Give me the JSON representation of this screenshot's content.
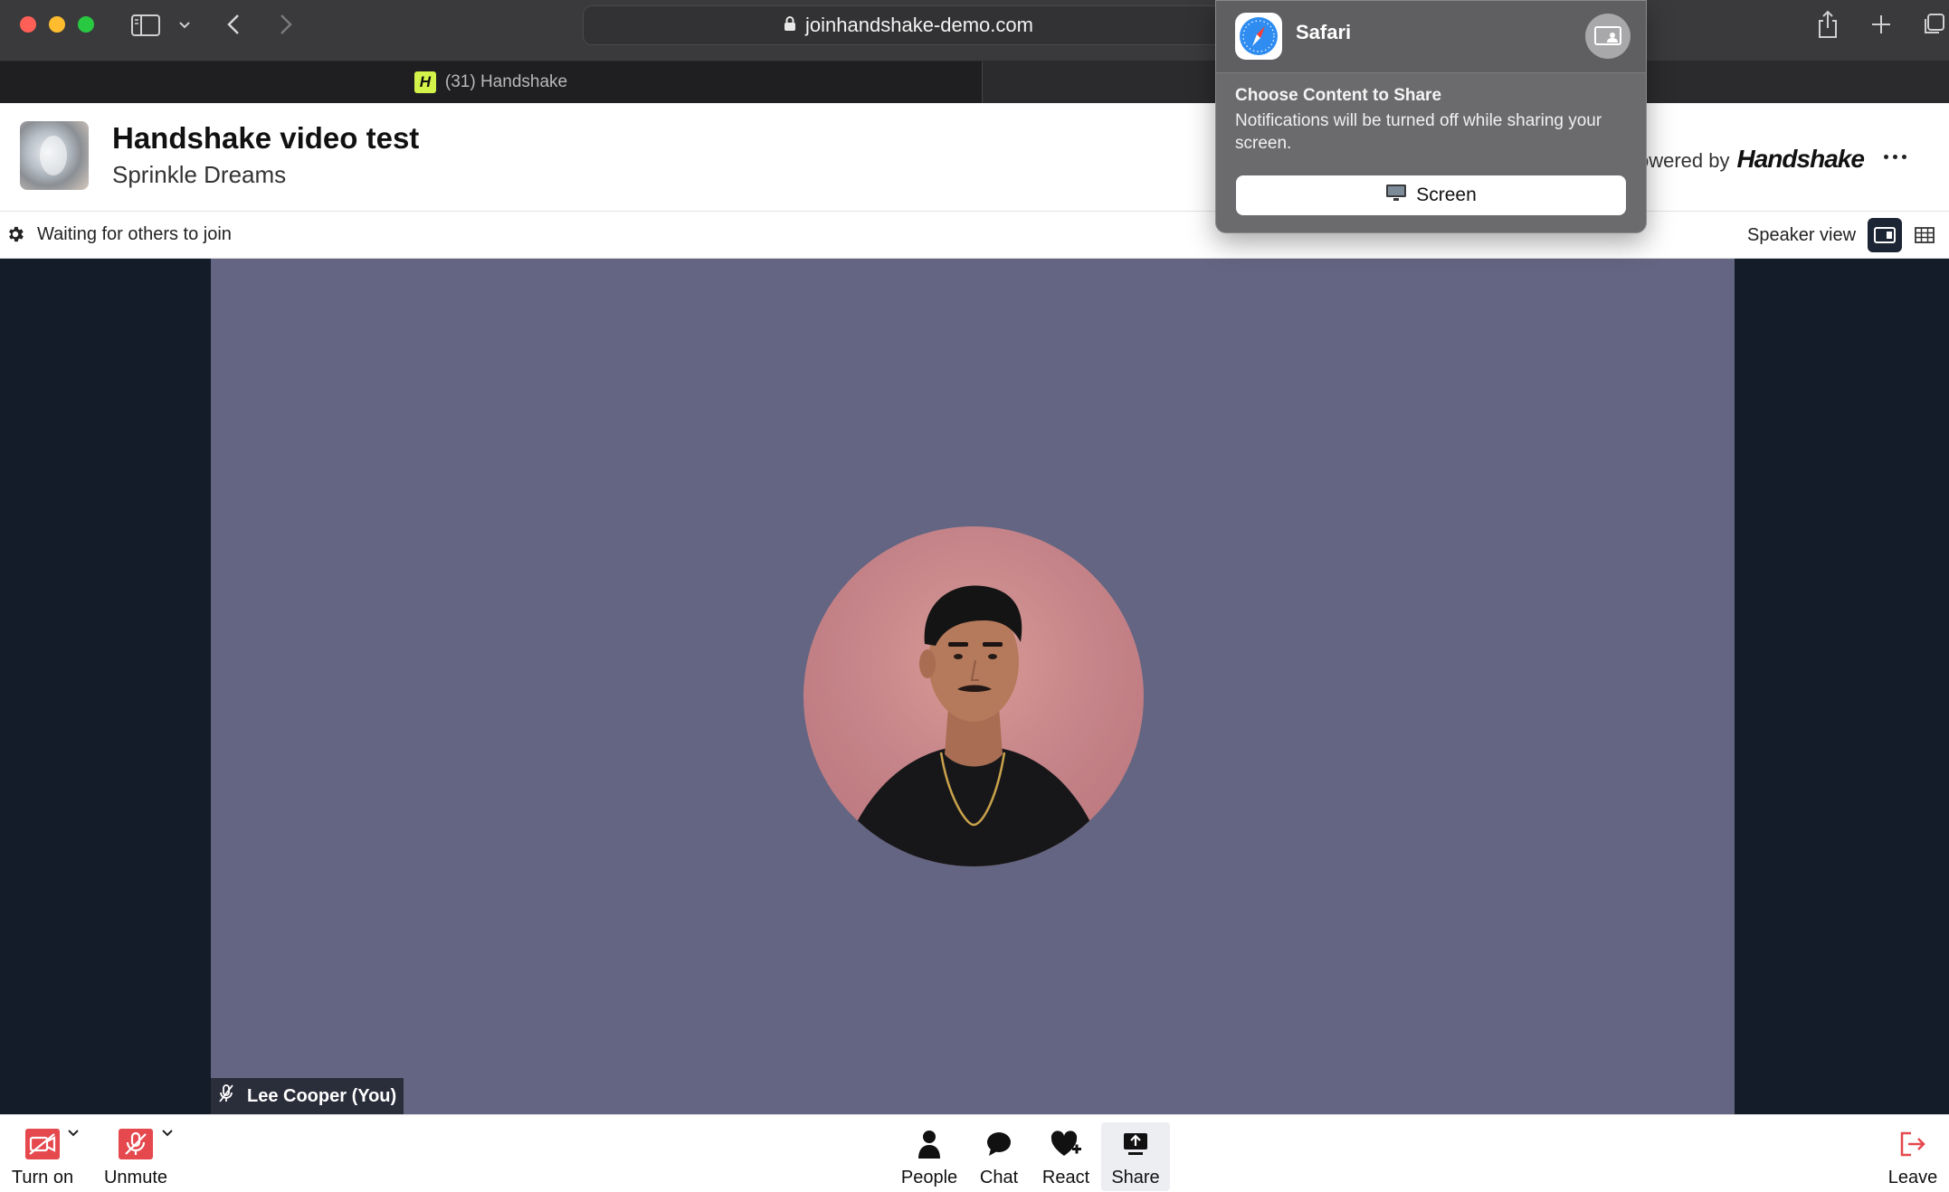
{
  "browser": {
    "url": "joinhandshake-demo.com",
    "tab_title": "(31) Handshake",
    "favicon_letter": "H"
  },
  "header": {
    "title": "Handshake video test",
    "subtitle": "Sprinkle Dreams",
    "powered_by": "owered by",
    "brand": "Handshake"
  },
  "status": {
    "message": "Waiting for others to join",
    "view_label": "Speaker view"
  },
  "participant": {
    "name": "Lee Cooper (You)"
  },
  "controls": {
    "camera": "Turn on",
    "mic": "Unmute",
    "people": "People",
    "chat": "Chat",
    "react": "React",
    "share": "Share",
    "leave": "Leave"
  },
  "share_popover": {
    "app_name": "Safari",
    "heading": "Choose Content to Share",
    "description": "Notifications will be turned off while sharing your screen.",
    "screen_button": "Screen"
  },
  "colors": {
    "stage_bg": "#141c2a",
    "tile_bg": "#636582",
    "danger": "#e5484d",
    "brand_accent": "#d4f34a"
  }
}
